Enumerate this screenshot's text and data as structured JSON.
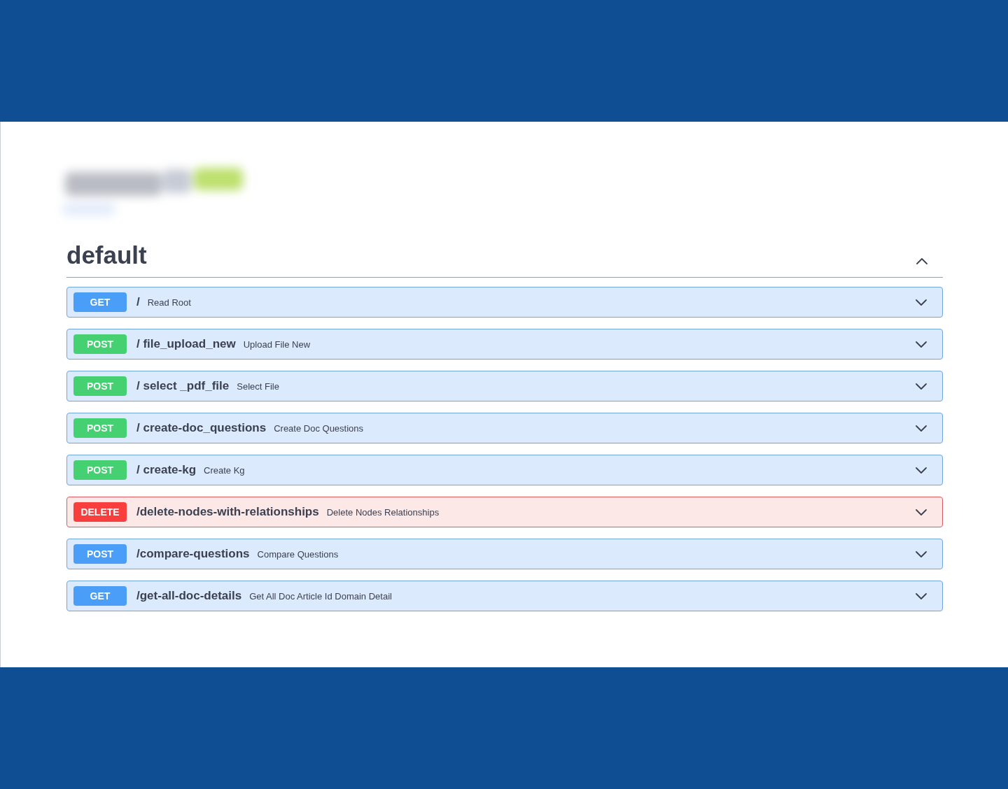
{
  "section": {
    "title": "default",
    "expanded": true
  },
  "operations": [
    {
      "method": "GET",
      "color": "#4a9ef8",
      "kind": "normal",
      "path": "/",
      "summary": "Read Root",
      "expanded": false
    },
    {
      "method": "POST",
      "color": "#45d172",
      "kind": "normal",
      "path": "/ file_upload_new",
      "summary": "Upload File New",
      "expanded": false
    },
    {
      "method": "POST",
      "color": "#45d172",
      "kind": "normal",
      "path": "/ select _pdf_file",
      "summary": "Select File",
      "expanded": false
    },
    {
      "method": "POST",
      "color": "#45d172",
      "kind": "normal",
      "path": "/ create-doc_questions",
      "summary": "Create Doc Questions",
      "expanded": false
    },
    {
      "method": "POST",
      "color": "#45d172",
      "kind": "normal",
      "path": "/ create-kg",
      "summary": "Create Kg",
      "expanded": false
    },
    {
      "method": "DELETE",
      "color": "#f93e3e",
      "kind": "danger",
      "path": "/delete-nodes-with-relationships",
      "summary": "Delete Nodes Relationships",
      "expanded": false
    },
    {
      "method": "POST",
      "color": "#4a9ef8",
      "kind": "normal",
      "path": "/compare-questions",
      "summary": "Compare Questions",
      "expanded": false
    },
    {
      "method": "GET",
      "color": "#4a9ef8",
      "kind": "normal",
      "path": "/get-all-doc-details",
      "summary": "Get All Doc Article Id Domain Detail",
      "expanded": false
    }
  ]
}
